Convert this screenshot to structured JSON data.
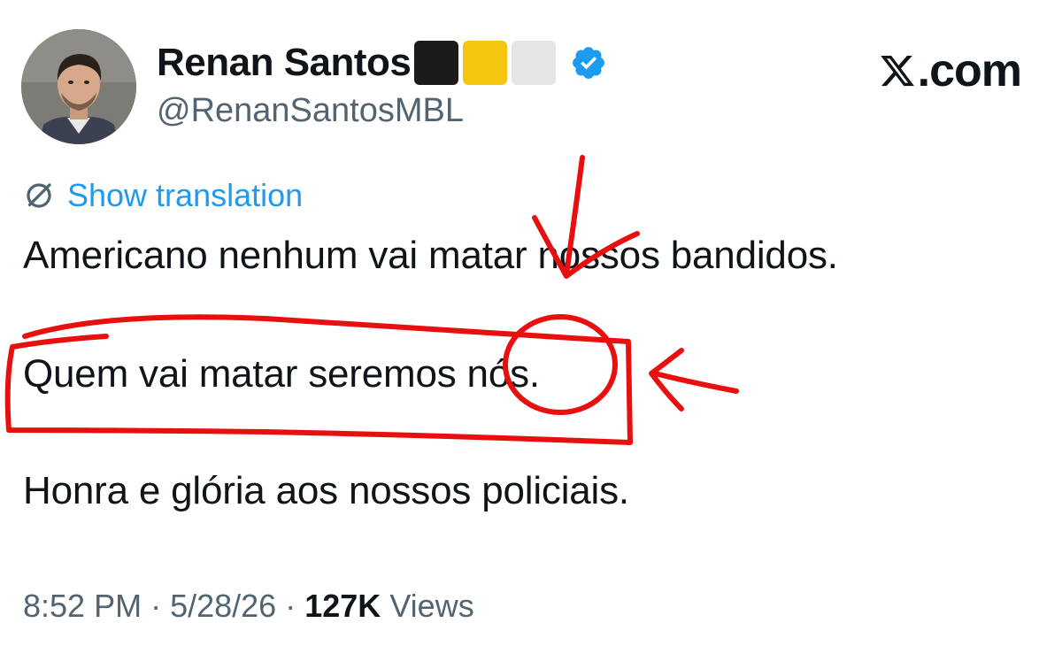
{
  "author": {
    "display_name": "Renan Santos",
    "flag_emojis": [
      "black-square",
      "yellow-square",
      "white-square"
    ],
    "verified": true,
    "handle": "@RenanSantosMBL"
  },
  "brand": {
    "site_label": ".com"
  },
  "translation": {
    "label": "Show translation"
  },
  "tweet": {
    "lines": [
      "Americano nenhum vai matar nossos bandidos.",
      "Quem vai matar seremos nós.",
      "Honra e glória aos nossos policiais."
    ]
  },
  "meta": {
    "time": "8:52 PM",
    "date": "5/28/26",
    "views_count": "127K",
    "views_label": "Views"
  },
  "colors": {
    "text": "#0f1419",
    "secondary": "#536471",
    "link": "#1d9bf0",
    "verified": "#1d9bf0",
    "annotation": "#e8100f"
  },
  "icons": [
    "avatar-photo",
    "verified-badge-icon",
    "x-logo-icon",
    "translate-globe-icon"
  ]
}
